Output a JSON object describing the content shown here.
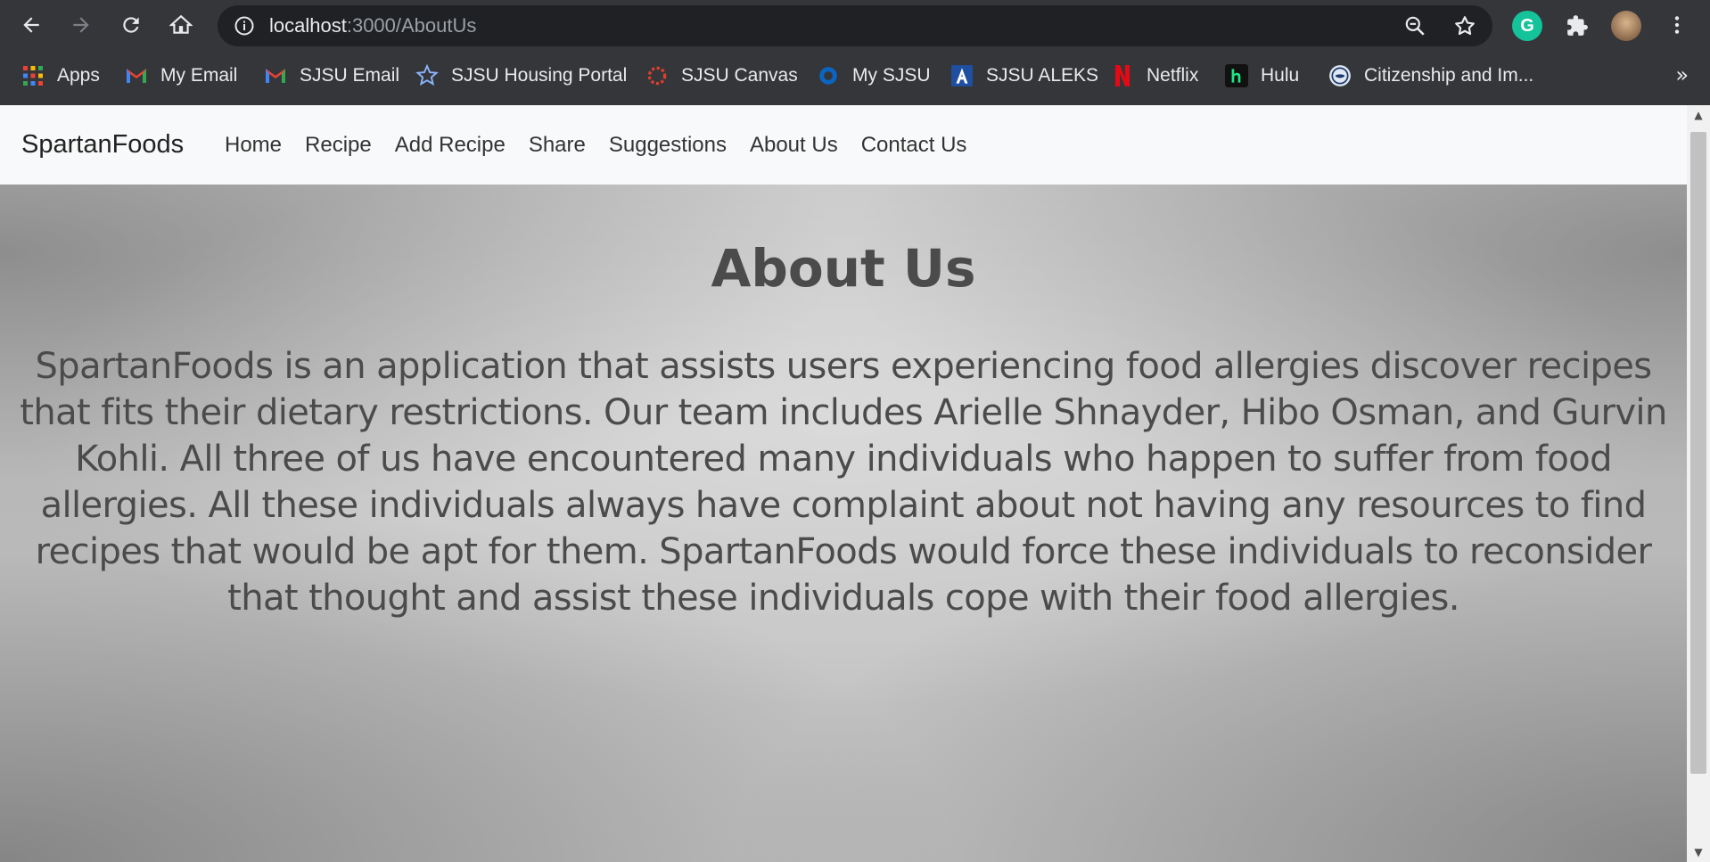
{
  "browser": {
    "address_host": "localhost",
    "address_path": ":3000/AboutUs",
    "bookmarks": [
      {
        "label": "Apps",
        "icon": "apps-grid-icon"
      },
      {
        "label": "My Email",
        "icon": "gmail-icon"
      },
      {
        "label": "SJSU Email",
        "icon": "gmail-icon"
      },
      {
        "label": "SJSU Housing Portal",
        "icon": "star-icon"
      },
      {
        "label": "SJSU Canvas",
        "icon": "canvas-icon"
      },
      {
        "label": "My SJSU",
        "icon": "circle-icon"
      },
      {
        "label": "SJSU ALEKS",
        "icon": "aleks-icon"
      },
      {
        "label": "Netflix",
        "icon": "netflix-icon"
      },
      {
        "label": "Hulu",
        "icon": "hulu-icon"
      },
      {
        "label": "Citizenship and Im...",
        "icon": "dhs-seal-icon"
      }
    ],
    "more_bookmarks": "»"
  },
  "site": {
    "brand": "SpartanFoods",
    "nav": [
      "Home",
      "Recipe",
      "Add Recipe",
      "Share",
      "Suggestions",
      "About Us",
      "Contact Us"
    ]
  },
  "about": {
    "title": "About Us",
    "body": "SpartanFoods is an application that assists users experiencing food allergies discover recipes that fits their dietary restrictions. Our team includes Arielle Shnayder, Hibo Osman, and Gurvin Kohli. All three of us have encountered many individuals who happen to suffer from food allergies. All these individuals always have complaint about not having any resources to find recipes that would be apt for them. SpartanFoods would force these individuals to reconsider that thought and assist these individuals cope with their food allergies."
  },
  "colors": {
    "chrome_bg": "#35363a",
    "navbar_bg": "#f8f9fa",
    "hero_text": "#4b4b4b"
  }
}
